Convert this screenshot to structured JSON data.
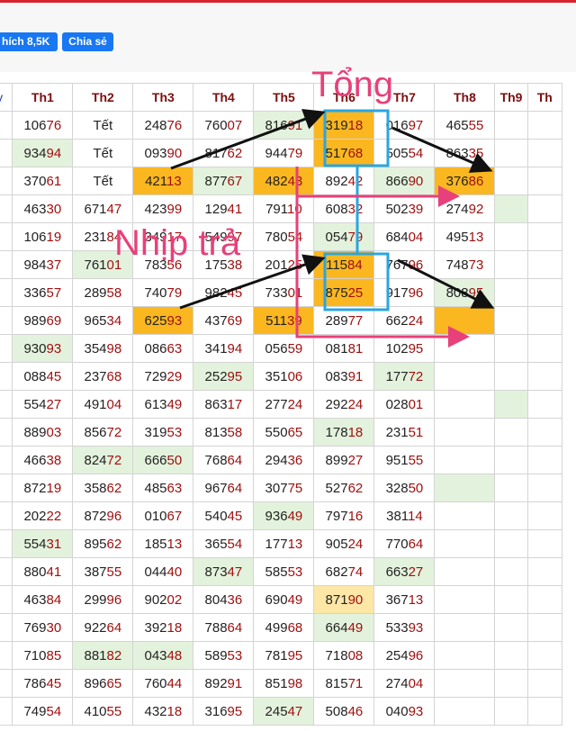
{
  "toolbar": {
    "like_label": "hích 8,5K",
    "share_label": "Chia sẻ"
  },
  "table": {
    "corner_label": "y",
    "headers": [
      "Th1",
      "Th2",
      "Th3",
      "Th4",
      "Th5",
      "Th6",
      "Th7",
      "Th8",
      "Th9",
      "Th"
    ],
    "rows": [
      [
        {
          "v": "10676"
        },
        {
          "v": "Tết"
        },
        {
          "v": "24876"
        },
        {
          "v": "76007"
        },
        {
          "v": "81691",
          "bg": "green"
        },
        {
          "v": "31918",
          "bg": "orange"
        },
        {
          "v": "01697"
        },
        {
          "v": "46555"
        },
        {
          "v": ""
        },
        {
          "v": ""
        }
      ],
      [
        {
          "v": "93494",
          "bg": "green"
        },
        {
          "v": "Tết"
        },
        {
          "v": "09390"
        },
        {
          "v": "81762"
        },
        {
          "v": "94479"
        },
        {
          "v": "51768",
          "bg": "orange"
        },
        {
          "v": "50554"
        },
        {
          "v": "86335"
        },
        {
          "v": ""
        },
        {
          "v": ""
        }
      ],
      [
        {
          "v": "37061"
        },
        {
          "v": "Tết"
        },
        {
          "v": "42113",
          "bg": "orange"
        },
        {
          "v": "87767",
          "bg": "green"
        },
        {
          "v": "48243",
          "bg": "orange"
        },
        {
          "v": "89242"
        },
        {
          "v": "86690",
          "bg": "green"
        },
        {
          "v": "37686",
          "bg": "orange"
        },
        {
          "v": ""
        },
        {
          "v": ""
        }
      ],
      [
        {
          "v": "46330"
        },
        {
          "v": "67147"
        },
        {
          "v": "42399"
        },
        {
          "v": "12941"
        },
        {
          "v": "79110"
        },
        {
          "v": "60832"
        },
        {
          "v": "50239"
        },
        {
          "v": "27492"
        },
        {
          "v": "",
          "bg": "green"
        },
        {
          "v": ""
        }
      ],
      [
        {
          "v": "10619"
        },
        {
          "v": "23184"
        },
        {
          "v": "34917"
        },
        {
          "v": "54997"
        },
        {
          "v": "78054"
        },
        {
          "v": "05479",
          "bg": "green"
        },
        {
          "v": "68404"
        },
        {
          "v": "49513"
        },
        {
          "v": ""
        },
        {
          "v": ""
        }
      ],
      [
        {
          "v": "98437"
        },
        {
          "v": "76101",
          "bg": "green"
        },
        {
          "v": "78356"
        },
        {
          "v": "17538"
        },
        {
          "v": "20125"
        },
        {
          "v": "11584",
          "bg": "orange"
        },
        {
          "v": "76796"
        },
        {
          "v": "74873"
        },
        {
          "v": ""
        },
        {
          "v": ""
        }
      ],
      [
        {
          "v": "33657"
        },
        {
          "v": "28958"
        },
        {
          "v": "74079"
        },
        {
          "v": "98245"
        },
        {
          "v": "73301"
        },
        {
          "v": "87525",
          "bg": "orange"
        },
        {
          "v": "91796"
        },
        {
          "v": "80895",
          "bg": "green"
        },
        {
          "v": ""
        },
        {
          "v": ""
        }
      ],
      [
        {
          "v": "98969"
        },
        {
          "v": "96534"
        },
        {
          "v": "62593",
          "bg": "orange"
        },
        {
          "v": "43769"
        },
        {
          "v": "51139",
          "bg": "orange"
        },
        {
          "v": "28977"
        },
        {
          "v": "66224"
        },
        {
          "v": "",
          "bg": "orange"
        },
        {
          "v": ""
        },
        {
          "v": ""
        }
      ],
      [
        {
          "v": "93093",
          "bg": "green"
        },
        {
          "v": "35498"
        },
        {
          "v": "08663"
        },
        {
          "v": "34194"
        },
        {
          "v": "05659"
        },
        {
          "v": "08181"
        },
        {
          "v": "10295"
        },
        {
          "v": ""
        },
        {
          "v": ""
        },
        {
          "v": ""
        }
      ],
      [
        {
          "v": "08845"
        },
        {
          "v": "23768"
        },
        {
          "v": "72929"
        },
        {
          "v": "25295",
          "bg": "green"
        },
        {
          "v": "35106"
        },
        {
          "v": "08391"
        },
        {
          "v": "17772",
          "bg": "green"
        },
        {
          "v": ""
        },
        {
          "v": ""
        },
        {
          "v": ""
        }
      ],
      [
        {
          "v": "55427"
        },
        {
          "v": "49104"
        },
        {
          "v": "61349"
        },
        {
          "v": "86317"
        },
        {
          "v": "27724"
        },
        {
          "v": "29224"
        },
        {
          "v": "02801"
        },
        {
          "v": ""
        },
        {
          "v": "",
          "bg": "green"
        },
        {
          "v": ""
        }
      ],
      [
        {
          "v": "88903"
        },
        {
          "v": "85672"
        },
        {
          "v": "31953"
        },
        {
          "v": "81358"
        },
        {
          "v": "55065"
        },
        {
          "v": "17818",
          "bg": "green"
        },
        {
          "v": "23151"
        },
        {
          "v": ""
        },
        {
          "v": ""
        },
        {
          "v": ""
        }
      ],
      [
        {
          "v": "46638"
        },
        {
          "v": "82472",
          "bg": "green"
        },
        {
          "v": "66650",
          "bg": "green"
        },
        {
          "v": "76864"
        },
        {
          "v": "29436"
        },
        {
          "v": "89927"
        },
        {
          "v": "95155"
        },
        {
          "v": ""
        },
        {
          "v": ""
        },
        {
          "v": ""
        }
      ],
      [
        {
          "v": "87219"
        },
        {
          "v": "35862"
        },
        {
          "v": "48563"
        },
        {
          "v": "96764"
        },
        {
          "v": "30775"
        },
        {
          "v": "52762"
        },
        {
          "v": "32850"
        },
        {
          "v": "",
          "bg": "green"
        },
        {
          "v": ""
        },
        {
          "v": ""
        }
      ],
      [
        {
          "v": "20222"
        },
        {
          "v": "87296"
        },
        {
          "v": "01067"
        },
        {
          "v": "54045"
        },
        {
          "v": "93649",
          "bg": "green"
        },
        {
          "v": "79716"
        },
        {
          "v": "38114"
        },
        {
          "v": ""
        },
        {
          "v": ""
        },
        {
          "v": ""
        }
      ],
      [
        {
          "v": "55431",
          "bg": "green"
        },
        {
          "v": "89562"
        },
        {
          "v": "18513"
        },
        {
          "v": "36554"
        },
        {
          "v": "17713"
        },
        {
          "v": "90524"
        },
        {
          "v": "77064"
        },
        {
          "v": ""
        },
        {
          "v": ""
        },
        {
          "v": ""
        }
      ],
      [
        {
          "v": "88041"
        },
        {
          "v": "38755"
        },
        {
          "v": "04440"
        },
        {
          "v": "87347",
          "bg": "green"
        },
        {
          "v": "58553"
        },
        {
          "v": "68274"
        },
        {
          "v": "66327",
          "bg": "green"
        },
        {
          "v": ""
        },
        {
          "v": ""
        },
        {
          "v": ""
        }
      ],
      [
        {
          "v": "46384"
        },
        {
          "v": "29996"
        },
        {
          "v": "90202"
        },
        {
          "v": "80436"
        },
        {
          "v": "69049"
        },
        {
          "v": "87190",
          "bg": "lightyellow"
        },
        {
          "v": "36713"
        },
        {
          "v": ""
        },
        {
          "v": ""
        },
        {
          "v": ""
        }
      ],
      [
        {
          "v": "76930"
        },
        {
          "v": "92264"
        },
        {
          "v": "39218"
        },
        {
          "v": "78864"
        },
        {
          "v": "49968"
        },
        {
          "v": "66449",
          "bg": "green"
        },
        {
          "v": "53393"
        },
        {
          "v": ""
        },
        {
          "v": ""
        },
        {
          "v": ""
        }
      ],
      [
        {
          "v": "71085"
        },
        {
          "v": "88182",
          "bg": "green"
        },
        {
          "v": "04348",
          "bg": "green"
        },
        {
          "v": "58953"
        },
        {
          "v": "78195"
        },
        {
          "v": "71808"
        },
        {
          "v": "25496"
        },
        {
          "v": ""
        },
        {
          "v": ""
        },
        {
          "v": ""
        }
      ],
      [
        {
          "v": "78645"
        },
        {
          "v": "89665"
        },
        {
          "v": "76044"
        },
        {
          "v": "89291"
        },
        {
          "v": "85198"
        },
        {
          "v": "81571"
        },
        {
          "v": "27404"
        },
        {
          "v": ""
        },
        {
          "v": ""
        },
        {
          "v": ""
        }
      ],
      [
        {
          "v": "74954"
        },
        {
          "v": "41055"
        },
        {
          "v": "43218"
        },
        {
          "v": "31695"
        },
        {
          "v": "24547",
          "bg": "green"
        },
        {
          "v": "50846"
        },
        {
          "v": "04093"
        },
        {
          "v": ""
        },
        {
          "v": ""
        },
        {
          "v": ""
        }
      ]
    ]
  },
  "annotations": {
    "tong": "Tổng",
    "nhip_tra": "Nhịp trả"
  },
  "colors": {
    "accent_pink": "#e8407a",
    "box_blue": "#2aa6e0",
    "arrow": "#111111",
    "highlight_orange": "#fab720",
    "highlight_green": "#e3f2dc",
    "buttons": "#1877f2",
    "header_text": "#7b0f0f"
  }
}
